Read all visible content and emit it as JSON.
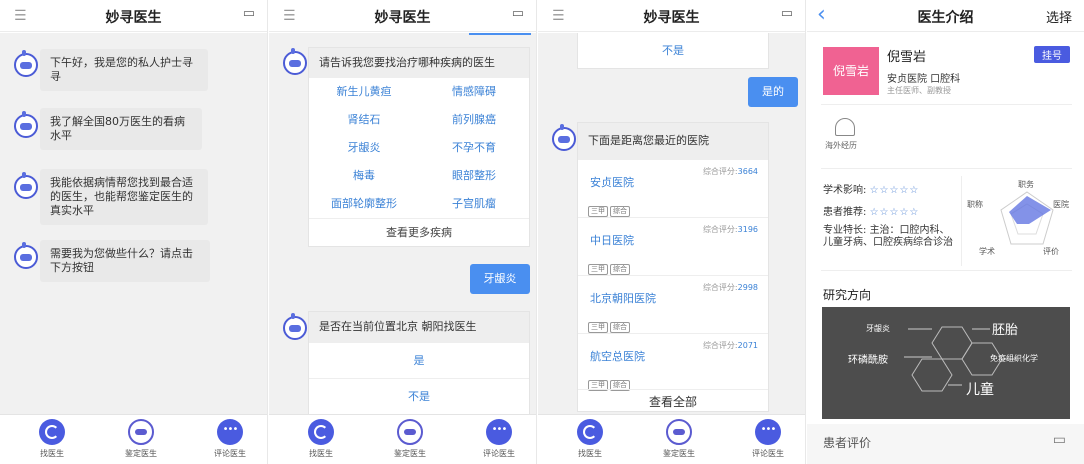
{
  "app_title": "妙寻医生",
  "colors": {
    "accent": "#4a8ff0",
    "link": "#3b82d6",
    "pink": "#f06292",
    "bubble": "#e9e9e9"
  },
  "tabbar": {
    "tab1": "找医生",
    "tab2": "鉴定医生",
    "tab3": "评论医生"
  },
  "screen1": {
    "messages": [
      "下午好，我是您的私人护士寻寻",
      "我了解全国80万医生的看病水平",
      "我能依据病情帮您找到最合适的医生，也能帮您鉴定医生的真实水平",
      "需要我为您做些什么？请点击下方按钮"
    ]
  },
  "screen2": {
    "prompt": "请告诉我您要找治疗哪种疾病的医生",
    "diseases": [
      "新生儿黄疸",
      "情感障碍",
      "肾结石",
      "前列腺癌",
      "牙龈炎",
      "不孕不育",
      "梅毒",
      "眼部整形",
      "面部轮廓整形",
      "子宫肌瘤"
    ],
    "more": "查看更多疾病",
    "user_reply": "牙龈炎",
    "location_question": "是否在当前位置北京 朝阳找医生",
    "yes": "是",
    "no": "不是"
  },
  "screen3": {
    "no": "不是",
    "user_reply": "是的",
    "nearest_title": "下面是距离您最近的医院",
    "score_label": "综合评分:",
    "hospitals": [
      {
        "name": "安贞医院",
        "score": "3664"
      },
      {
        "name": "中日医院",
        "score": "3196"
      },
      {
        "name": "北京朝阳医院",
        "score": "2998"
      },
      {
        "name": "航空总医院",
        "score": "2071"
      }
    ],
    "tag1": "三甲",
    "tag2": "综合",
    "view_all": "查看全部"
  },
  "screen4": {
    "back": "‹",
    "title": "医生介绍",
    "select": "选择",
    "doctor_name": "倪雪岩",
    "register": "挂号",
    "hospital_dept": "安贞医院 口腔科",
    "titles": "主任医师、副教授",
    "overseas": "海外经历",
    "academic_label": "学术影响:",
    "patient_label": "患者推荐:",
    "stars": "☆☆☆☆☆",
    "specialty_label": "专业特长:",
    "specialty": "主治：口腔内科、儿童牙病、口腔疾病综合诊治",
    "radar": {
      "top": "职务",
      "right": "医院",
      "left": "职称",
      "bottom_left": "学术",
      "bottom_right": "评价"
    },
    "research_title": "研究方向",
    "research_terms": [
      "牙龈炎",
      "胚胎",
      "环磷酰胺",
      "免疫组织化学",
      "儿童"
    ],
    "reviews_title": "患者评价"
  }
}
